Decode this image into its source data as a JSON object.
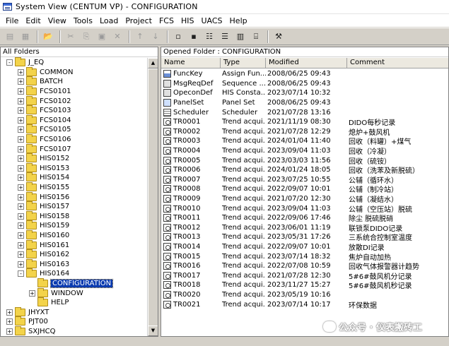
{
  "window": {
    "title": "System View (CENTUM VP) - CONFIGURATION"
  },
  "menu": [
    "File",
    "Edit",
    "View",
    "Tools",
    "Load",
    "Project",
    "FCS",
    "HIS",
    "UACS",
    "Help"
  ],
  "toolbar": {
    "buttons": [
      {
        "name": "toolbar-button-1-icon",
        "glyph": "▤",
        "enabled": false
      },
      {
        "name": "toolbar-button-2-icon",
        "glyph": "▦",
        "enabled": false
      },
      {
        "name": "open-folder-icon",
        "glyph": "📂",
        "enabled": true
      },
      {
        "name": "cut-icon",
        "glyph": "✂",
        "enabled": false
      },
      {
        "name": "copy-icon",
        "glyph": "⎘",
        "enabled": false
      },
      {
        "name": "paste-icon",
        "glyph": "▣",
        "enabled": false
      },
      {
        "name": "delete-icon",
        "glyph": "✕",
        "enabled": false
      },
      {
        "name": "up-arrow-icon",
        "glyph": "↑",
        "enabled": false
      },
      {
        "name": "down-arrow-icon",
        "glyph": "↓",
        "enabled": false
      },
      {
        "name": "large-icons-icon",
        "glyph": "▫",
        "enabled": true
      },
      {
        "name": "small-icons-icon",
        "glyph": "▪",
        "enabled": true
      },
      {
        "name": "list-view-icon",
        "glyph": "☷",
        "enabled": true
      },
      {
        "name": "details-view-icon",
        "glyph": "☰",
        "enabled": true
      },
      {
        "name": "properties-icon",
        "glyph": "▥",
        "enabled": true
      },
      {
        "name": "tree-view-icon",
        "glyph": "⌸",
        "enabled": true
      },
      {
        "name": "help-tool-icon",
        "glyph": "⚒",
        "enabled": true
      }
    ]
  },
  "left_pane": {
    "header": "All Folders",
    "tree": [
      {
        "label": "J_EQ",
        "level": 1,
        "expander": "-"
      },
      {
        "label": "COMMON",
        "level": 2,
        "expander": "+"
      },
      {
        "label": "BATCH",
        "level": 2,
        "expander": "+"
      },
      {
        "label": "FCS0101",
        "level": 2,
        "expander": "+"
      },
      {
        "label": "FCS0102",
        "level": 2,
        "expander": "+"
      },
      {
        "label": "FCS0103",
        "level": 2,
        "expander": "+"
      },
      {
        "label": "FCS0104",
        "level": 2,
        "expander": "+"
      },
      {
        "label": "FCS0105",
        "level": 2,
        "expander": "+"
      },
      {
        "label": "FCS0106",
        "level": 2,
        "expander": "+"
      },
      {
        "label": "FCS0107",
        "level": 2,
        "expander": "+"
      },
      {
        "label": "HIS0152",
        "level": 2,
        "expander": "+"
      },
      {
        "label": "HIS0153",
        "level": 2,
        "expander": "+"
      },
      {
        "label": "HIS0154",
        "level": 2,
        "expander": "+"
      },
      {
        "label": "HIS0155",
        "level": 2,
        "expander": "+"
      },
      {
        "label": "HIS0156",
        "level": 2,
        "expander": "+"
      },
      {
        "label": "HIS0157",
        "level": 2,
        "expander": "+"
      },
      {
        "label": "HIS0158",
        "level": 2,
        "expander": "+"
      },
      {
        "label": "HIS0159",
        "level": 2,
        "expander": "+"
      },
      {
        "label": "HIS0160",
        "level": 2,
        "expander": "+"
      },
      {
        "label": "HIS0161",
        "level": 2,
        "expander": "+"
      },
      {
        "label": "HIS0162",
        "level": 2,
        "expander": "+"
      },
      {
        "label": "HIS0163",
        "level": 2,
        "expander": "+"
      },
      {
        "label": "HIS0164",
        "level": 2,
        "expander": "-"
      },
      {
        "label": "CONFIGURATION",
        "level": 3,
        "expander": "",
        "selected": true
      },
      {
        "label": "WINDOW",
        "level": 3,
        "expander": "+"
      },
      {
        "label": "HELP",
        "level": 3,
        "expander": ""
      },
      {
        "label": "JHYXT",
        "level": 1,
        "expander": "+"
      },
      {
        "label": "PJT00",
        "level": 1,
        "expander": "+"
      },
      {
        "label": "SXJHCQ",
        "level": 1,
        "expander": "+"
      }
    ]
  },
  "right_pane": {
    "header": "Opened Folder : CONFIGURATION",
    "columns": [
      "Name",
      "Type",
      "Modified",
      "Comment"
    ],
    "files": [
      {
        "icon": "func",
        "name": "FuncKey",
        "type": "Assign Fun...",
        "modified": "2008/06/25 09:43",
        "comment": ""
      },
      {
        "icon": "const",
        "name": "MsgReqDef",
        "type": "Sequence ...",
        "modified": "2008/06/25 09:43",
        "comment": ""
      },
      {
        "icon": "const",
        "name": "OpeconDef",
        "type": "HIS Consta...",
        "modified": "2023/07/14 10:32",
        "comment": ""
      },
      {
        "icon": "panel",
        "name": "PanelSet",
        "type": "Panel Set",
        "modified": "2008/06/25 09:43",
        "comment": ""
      },
      {
        "icon": "sched",
        "name": "Scheduler",
        "type": "Scheduler",
        "modified": "2021/07/28 13:16",
        "comment": ""
      },
      {
        "icon": "trend",
        "name": "TR0001",
        "type": "Trend acqui...",
        "modified": "2021/11/19 08:30",
        "comment": "DIDO每秒记录"
      },
      {
        "icon": "trend",
        "name": "TR0002",
        "type": "Trend acqui...",
        "modified": "2021/07/28 12:29",
        "comment": "熄炉+鼓风机"
      },
      {
        "icon": "trend",
        "name": "TR0003",
        "type": "Trend acqui...",
        "modified": "2024/01/04 11:40",
        "comment": "回收（料罐）+煤气"
      },
      {
        "icon": "trend",
        "name": "TR0004",
        "type": "Trend acqui...",
        "modified": "2023/09/04 11:03",
        "comment": "回收（冷凝）"
      },
      {
        "icon": "trend",
        "name": "TR0005",
        "type": "Trend acqui...",
        "modified": "2023/03/03 11:56",
        "comment": "回收（硫铵）"
      },
      {
        "icon": "trend",
        "name": "TR0006",
        "type": "Trend acqui...",
        "modified": "2024/01/24 18:05",
        "comment": "回收（洗苯及新脱硫）"
      },
      {
        "icon": "trend",
        "name": "TR0007",
        "type": "Trend acqui...",
        "modified": "2023/07/25 10:55",
        "comment": "公辅（循环水）"
      },
      {
        "icon": "trend",
        "name": "TR0008",
        "type": "Trend acqui...",
        "modified": "2022/09/07 10:01",
        "comment": "公辅（制冷站）"
      },
      {
        "icon": "trend",
        "name": "TR0009",
        "type": "Trend acqui...",
        "modified": "2021/07/20 12:30",
        "comment": "公辅（凝结水）"
      },
      {
        "icon": "trend",
        "name": "TR0010",
        "type": "Trend acqui...",
        "modified": "2023/09/04 11:03",
        "comment": "公辅（空压站）脱硫"
      },
      {
        "icon": "trend",
        "name": "TR0011",
        "type": "Trend acqui...",
        "modified": "2022/09/06 17:46",
        "comment": "除尘 脱硫脱硝"
      },
      {
        "icon": "trend",
        "name": "TR0012",
        "type": "Trend acqui...",
        "modified": "2023/06/01 11:19",
        "comment": "联锁泵DIDO记录"
      },
      {
        "icon": "trend",
        "name": "TR0013",
        "type": "Trend acqui...",
        "modified": "2023/05/31 17:26",
        "comment": "三系统合控制室温度"
      },
      {
        "icon": "trend",
        "name": "TR0014",
        "type": "Trend acqui...",
        "modified": "2022/09/07 10:01",
        "comment": "放散DI记录"
      },
      {
        "icon": "trend",
        "name": "TR0015",
        "type": "Trend acqui...",
        "modified": "2023/07/14 18:32",
        "comment": "焦炉自动加热"
      },
      {
        "icon": "trend",
        "name": "TR0016",
        "type": "Trend acqui...",
        "modified": "2022/07/08 10:59",
        "comment": "回收气体报警器计趋势"
      },
      {
        "icon": "trend",
        "name": "TR0017",
        "type": "Trend acqui...",
        "modified": "2021/07/28 12:30",
        "comment": "5#6#鼓风机分记录"
      },
      {
        "icon": "trend",
        "name": "TR0018",
        "type": "Trend acqui...",
        "modified": "2023/11/27 15:27",
        "comment": "5#6#鼓风机秒记录"
      },
      {
        "icon": "trend",
        "name": "TR0020",
        "type": "Trend acqui...",
        "modified": "2023/05/19 10:16",
        "comment": ""
      },
      {
        "icon": "trend",
        "name": "TR0021",
        "type": "Trend acqui...",
        "modified": "2023/07/14 10:17",
        "comment": "环保数据"
      }
    ]
  },
  "watermark": {
    "text": "公众号 · 仪表搬砖工"
  }
}
